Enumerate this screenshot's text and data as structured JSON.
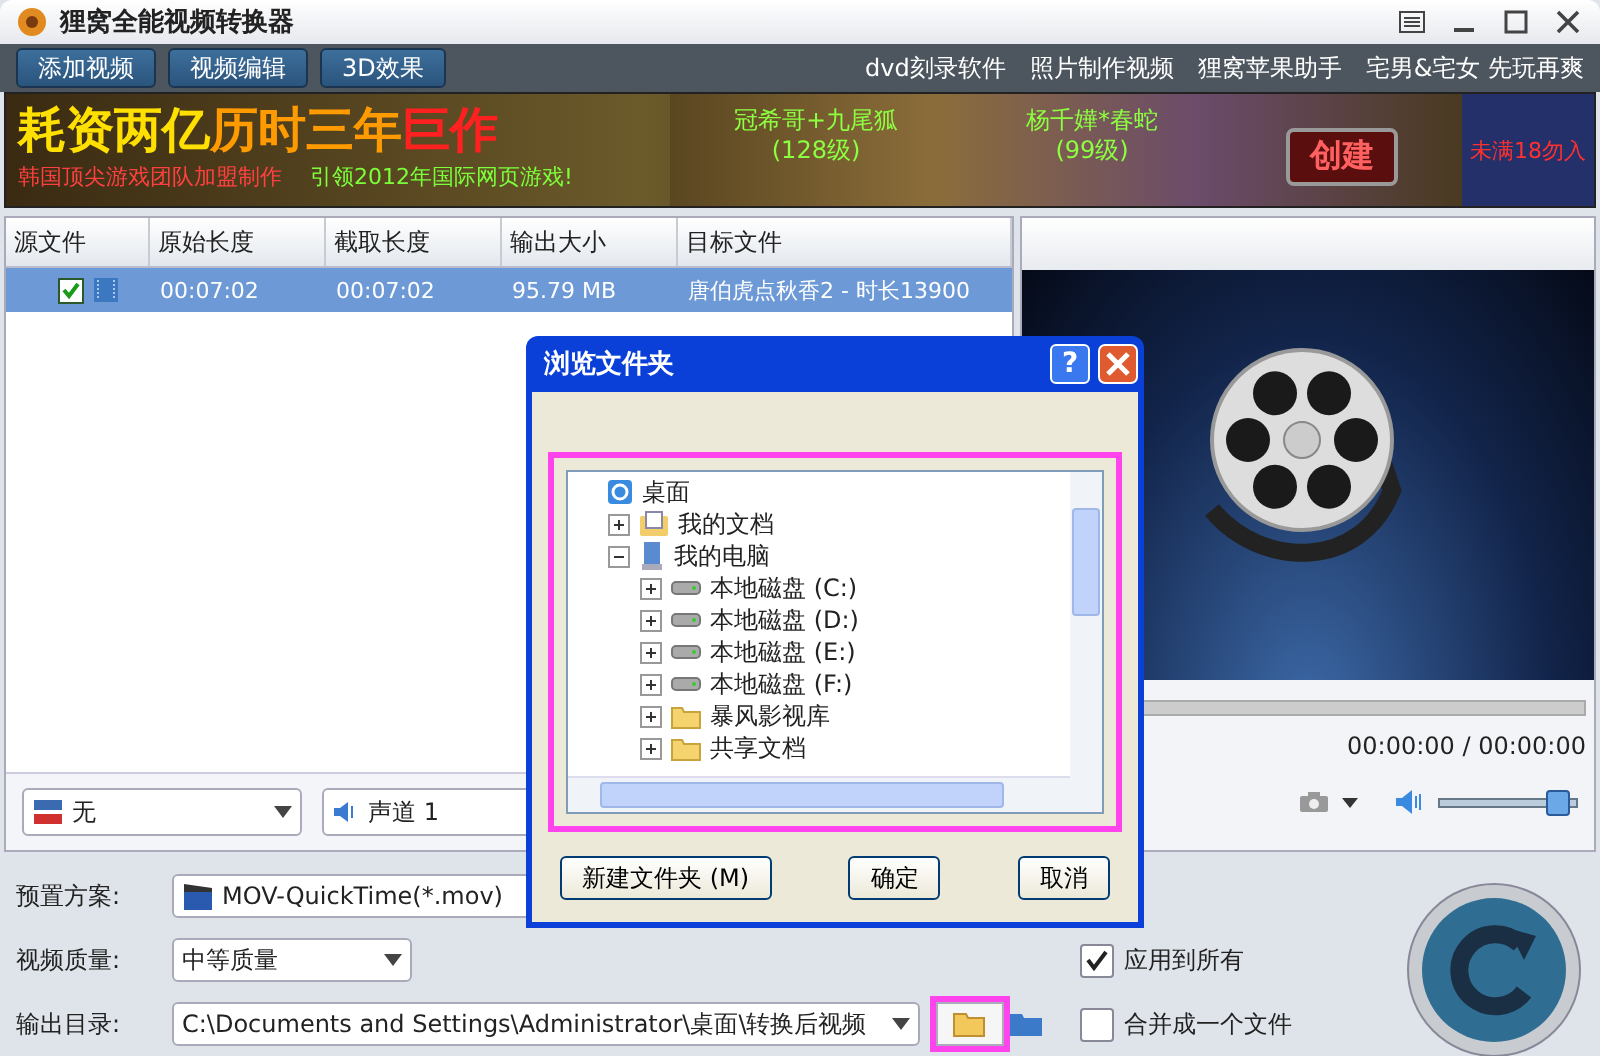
{
  "window": {
    "title": "狸窝全能视频转换器"
  },
  "toolbar": {
    "buttons": [
      "添加视频",
      "视频编辑",
      "3D效果"
    ],
    "links": [
      "dvd刻录软件",
      "照片制作视频",
      "狸窝苹果助手",
      "宅男&宅女 先玩再爽"
    ]
  },
  "banner": {
    "headline": [
      "耗资两亿",
      "历时三年",
      "巨作"
    ],
    "subline": [
      "韩国顶尖游戏团队加盟制作",
      "引领2012年国际网页游戏!"
    ],
    "characters": [
      {
        "name": "冠希哥+九尾狐",
        "level": "(128级)"
      },
      {
        "name": "杨千嬅*春蛇",
        "level": "(99级)"
      }
    ],
    "button": "创建",
    "notice": "未满18勿入"
  },
  "file_table": {
    "columns": [
      "源文件",
      "原始长度",
      "截取长度",
      "输出大小",
      "目标文件"
    ],
    "rows": [
      {
        "checked": true,
        "selected": true,
        "cells": [
          "",
          "00:07:02",
          "00:07:02",
          "95.79 MB",
          "唐伯虎点秋香2 - 时长13900"
        ]
      }
    ]
  },
  "subtitle_select": {
    "value": "无"
  },
  "audio_track_select": {
    "value": "声道 1"
  },
  "preview": {
    "time": "00:00:00 / 00:00:00",
    "volume": {
      "level": 0.93
    }
  },
  "settings": {
    "preset_label": "预置方案:",
    "preset_value": "MOV-QuickTime(*.mov)",
    "quality_label": "视频质量:",
    "quality_value": "中等质量",
    "output_label": "输出目录:",
    "output_value": "C:\\Documents and Settings\\Administrator\\桌面\\转换后视频",
    "browse_highlighted": true,
    "apply_all": {
      "label": "应用到所有",
      "checked": true
    },
    "merge": {
      "label": "合并成一个文件",
      "checked": false
    }
  },
  "dialog": {
    "title": "浏览文件夹",
    "help_button": "?",
    "tree_highlighted": true,
    "tree": [
      {
        "label": "桌面",
        "kind": "desktop",
        "children": [
          {
            "label": "我的文档",
            "kind": "documents",
            "expanded": false
          },
          {
            "label": "我的电脑",
            "kind": "computer",
            "expanded": true,
            "children": [
              {
                "label": "本地磁盘 (C:)",
                "kind": "drive",
                "expanded": false
              },
              {
                "label": "本地磁盘 (D:)",
                "kind": "drive",
                "expanded": false
              },
              {
                "label": "本地磁盘 (E:)",
                "kind": "drive",
                "expanded": false
              },
              {
                "label": "本地磁盘 (F:)",
                "kind": "drive",
                "expanded": false
              },
              {
                "label": "暴风影视库",
                "kind": "folder",
                "expanded": false
              },
              {
                "label": "共享文档",
                "kind": "folder",
                "expanded": false
              }
            ]
          }
        ]
      }
    ],
    "buttons": [
      "新建文件夹 (M)",
      "确定",
      "取消"
    ]
  }
}
